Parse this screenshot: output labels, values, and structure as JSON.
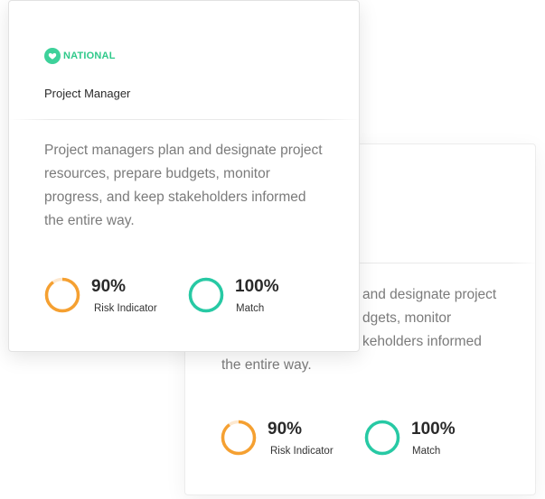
{
  "back_card": {
    "description": "Project managers plan and designate project resources, prepare budgets, monitor progress, and keep stakeholders informed the entire way.",
    "desc_lines": [
      " and designate project",
      "dgets, monitor",
      "keholders informed",
      "the entire way."
    ],
    "metrics": [
      {
        "value": "90%",
        "label": "Risk Indicator",
        "fraction": 0.9,
        "color": "#f5a031"
      },
      {
        "value": "100%",
        "label": "Match",
        "fraction": 1.0,
        "color": "#27c9a4"
      }
    ]
  },
  "front_card": {
    "badge": {
      "label": "NATIONAL",
      "icon": "heart-icon",
      "color": "#3dd19a"
    },
    "title": "Project Manager",
    "desc_lines": [
      "Project managers plan and designate project",
      "resources, prepare budgets, monitor",
      "progress, and keep stakeholders informed",
      "the entire way."
    ],
    "metrics": [
      {
        "value": "90%",
        "label": "Risk Indicator",
        "fraction": 0.9,
        "color": "#f5a031"
      },
      {
        "value": "100%",
        "label": "Match",
        "fraction": 1.0,
        "color": "#27c9a4"
      }
    ]
  }
}
